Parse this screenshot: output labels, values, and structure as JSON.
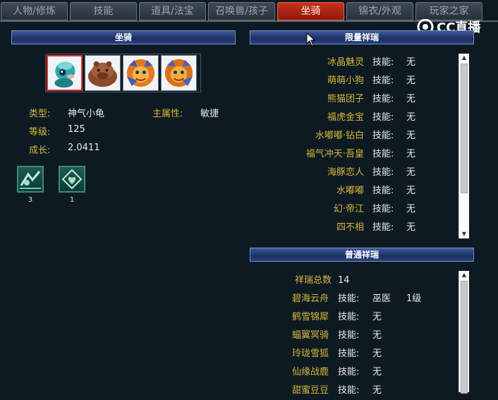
{
  "tabs": [
    {
      "label": "人物/修炼",
      "active": false
    },
    {
      "label": "技能",
      "active": false
    },
    {
      "label": "道具/法宝",
      "active": false
    },
    {
      "label": "召唤兽/孩子",
      "active": false
    },
    {
      "label": "坐骑",
      "active": true
    },
    {
      "label": "锦衣/外观",
      "active": false
    },
    {
      "label": "玩家之家",
      "active": false
    }
  ],
  "watermark": {
    "text": "CC直播"
  },
  "mount": {
    "header": "坐骑",
    "type_label": "类型:",
    "type_value": "神气小龟",
    "attr_label": "主属性:",
    "attr_value": "敏捷",
    "level_label": "等级:",
    "level_value": "125",
    "growth_label": "成长:",
    "growth_value": "2.0411",
    "skills": [
      {
        "icon": "dragon-emblem-icon",
        "count": "3"
      },
      {
        "icon": "heart-crest-icon",
        "count": "1"
      }
    ],
    "slots": [
      "turtle",
      "capybara",
      "lion",
      "lion"
    ]
  },
  "limited": {
    "header": "限量祥瑞",
    "skill_label": "技能:",
    "items": [
      {
        "name": "冰晶魅灵",
        "skill": "无"
      },
      {
        "name": "萌萌小狗",
        "skill": "无"
      },
      {
        "name": "熊猫团子",
        "skill": "无"
      },
      {
        "name": "福虎金宝",
        "skill": "无"
      },
      {
        "name": "水嘟嘟·钻白",
        "skill": "无"
      },
      {
        "name": "福气冲天·吾皇",
        "skill": "无"
      },
      {
        "name": "海豚恋人",
        "skill": "无"
      },
      {
        "name": "水嘟嘟",
        "skill": "无"
      },
      {
        "name": "幻·帝江",
        "skill": "无"
      },
      {
        "name": "四不相",
        "skill": "无"
      }
    ]
  },
  "normal": {
    "header": "普通祥瑞",
    "total_label": "祥瑞总数",
    "total_value": "14",
    "skill_label": "技能:",
    "items": [
      {
        "name": "碧海云舟",
        "skill": "巫医",
        "level": "1级"
      },
      {
        "name": "鹤雪锦犀",
        "skill": "无",
        "level": ""
      },
      {
        "name": "蝠翼冥骑",
        "skill": "无",
        "level": ""
      },
      {
        "name": "玲珑雪狐",
        "skill": "无",
        "level": ""
      },
      {
        "name": "仙缘战鹿",
        "skill": "无",
        "level": ""
      },
      {
        "name": "甜蜜豆豆",
        "skill": "无",
        "level": ""
      }
    ]
  }
}
